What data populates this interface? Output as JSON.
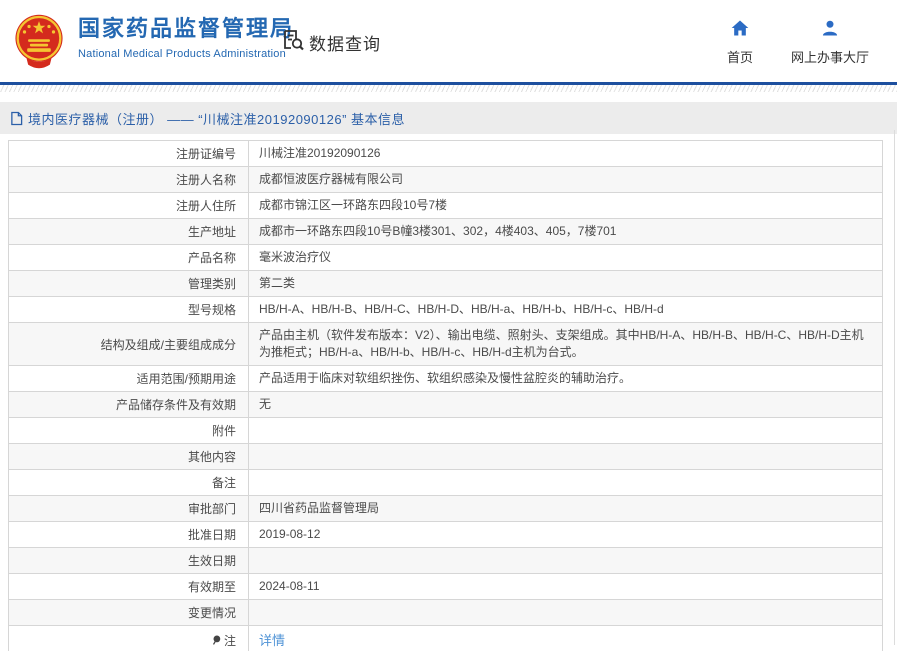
{
  "colors": {
    "brand_blue": "#2468b2",
    "header_line_blue": "#1d4f9e",
    "nav_icon_blue": "#2b6bc4",
    "breadcrumb_bg": "#ececec",
    "breadcrumb_text": "#2b5fa8",
    "link_blue": "#4f93d6",
    "table_border": "#c3c3c3",
    "row_alt_bg": "#f7f7f7",
    "emblem_red": "#d42a1d",
    "emblem_gold": "#f5c531"
  },
  "header": {
    "logo_icon": "national-emblem-icon",
    "title": "国家药品监督管理局",
    "subtitle": "National Medical Products Administration",
    "search_section": {
      "icon": "document-search-icon",
      "label": "数据查询"
    },
    "nav": [
      {
        "icon": "home-icon",
        "label": "首页"
      },
      {
        "icon": "user-icon",
        "label": "网上办事大厅"
      }
    ]
  },
  "breadcrumb": {
    "icon": "document-icon",
    "text": "境内医疗器械（注册） —— “川械注准20192090126” 基本信息"
  },
  "detail_table": {
    "rows": [
      {
        "label": "注册证编号",
        "value": "川械注准20192090126"
      },
      {
        "label": "注册人名称",
        "value": "成都恒波医疗器械有限公司"
      },
      {
        "label": "注册人住所",
        "value": "成都市锦江区一环路东四段10号7楼"
      },
      {
        "label": "生产地址",
        "value": "成都市一环路东四段10号B幢3楼301、302，4楼403、405，7楼701"
      },
      {
        "label": "产品名称",
        "value": "毫米波治疗仪"
      },
      {
        "label": "管理类别",
        "value": "第二类"
      },
      {
        "label": "型号规格",
        "value": "HB/H-A、HB/H-B、HB/H-C、HB/H-D、HB/H-a、HB/H-b、HB/H-c、HB/H-d"
      },
      {
        "label": "结构及组成/主要组成成分",
        "value": "产品由主机（软件发布版本：V2）、输出电缆、照射头、支架组成。其中HB/H-A、HB/H-B、HB/H-C、HB/H-D主机为推柜式；HB/H-a、HB/H-b、HB/H-c、HB/H-d主机为台式。"
      },
      {
        "label": "适用范围/预期用途",
        "value": "产品适用于临床对软组织挫伤、软组织感染及慢性盆腔炎的辅助治疗。"
      },
      {
        "label": "产品储存条件及有效期",
        "value": "无"
      },
      {
        "label": "附件",
        "value": ""
      },
      {
        "label": "其他内容",
        "value": ""
      },
      {
        "label": "备注",
        "value": ""
      },
      {
        "label": "审批部门",
        "value": "四川省药品监督管理局"
      },
      {
        "label": "批准日期",
        "value": "2019-08-12"
      },
      {
        "label": "生效日期",
        "value": ""
      },
      {
        "label": "有效期至",
        "value": "2024-08-11"
      },
      {
        "label": "变更情况",
        "value": ""
      },
      {
        "label": "注",
        "label_icon": "pin-icon",
        "value": "详情",
        "value_is_link": true
      }
    ]
  }
}
